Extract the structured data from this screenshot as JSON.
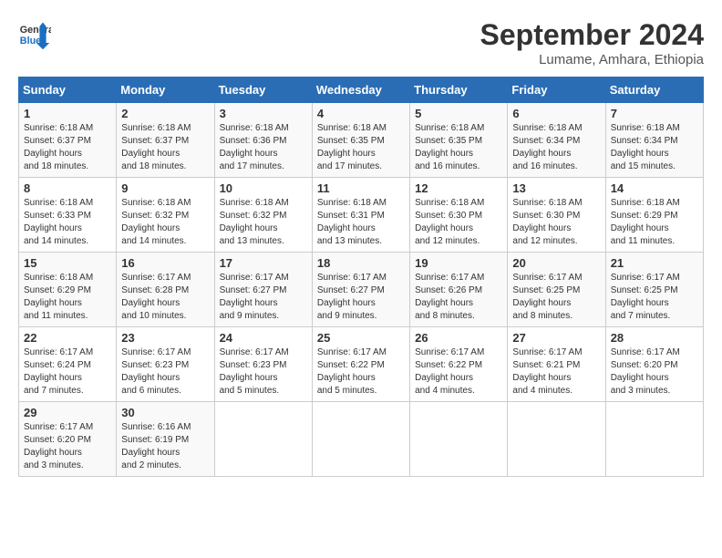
{
  "header": {
    "logo_line1": "General",
    "logo_line2": "Blue",
    "month": "September 2024",
    "location": "Lumame, Amhara, Ethiopia"
  },
  "weekdays": [
    "Sunday",
    "Monday",
    "Tuesday",
    "Wednesday",
    "Thursday",
    "Friday",
    "Saturday"
  ],
  "weeks": [
    [
      {
        "day": "1",
        "rise": "6:18 AM",
        "set": "6:37 PM",
        "daylight": "12 hours and 18 minutes."
      },
      {
        "day": "2",
        "rise": "6:18 AM",
        "set": "6:37 PM",
        "daylight": "12 hours and 18 minutes."
      },
      {
        "day": "3",
        "rise": "6:18 AM",
        "set": "6:36 PM",
        "daylight": "12 hours and 17 minutes."
      },
      {
        "day": "4",
        "rise": "6:18 AM",
        "set": "6:35 PM",
        "daylight": "12 hours and 17 minutes."
      },
      {
        "day": "5",
        "rise": "6:18 AM",
        "set": "6:35 PM",
        "daylight": "12 hours and 16 minutes."
      },
      {
        "day": "6",
        "rise": "6:18 AM",
        "set": "6:34 PM",
        "daylight": "12 hours and 16 minutes."
      },
      {
        "day": "7",
        "rise": "6:18 AM",
        "set": "6:34 PM",
        "daylight": "12 hours and 15 minutes."
      }
    ],
    [
      {
        "day": "8",
        "rise": "6:18 AM",
        "set": "6:33 PM",
        "daylight": "12 hours and 14 minutes."
      },
      {
        "day": "9",
        "rise": "6:18 AM",
        "set": "6:32 PM",
        "daylight": "12 hours and 14 minutes."
      },
      {
        "day": "10",
        "rise": "6:18 AM",
        "set": "6:32 PM",
        "daylight": "12 hours and 13 minutes."
      },
      {
        "day": "11",
        "rise": "6:18 AM",
        "set": "6:31 PM",
        "daylight": "12 hours and 13 minutes."
      },
      {
        "day": "12",
        "rise": "6:18 AM",
        "set": "6:30 PM",
        "daylight": "12 hours and 12 minutes."
      },
      {
        "day": "13",
        "rise": "6:18 AM",
        "set": "6:30 PM",
        "daylight": "12 hours and 12 minutes."
      },
      {
        "day": "14",
        "rise": "6:18 AM",
        "set": "6:29 PM",
        "daylight": "12 hours and 11 minutes."
      }
    ],
    [
      {
        "day": "15",
        "rise": "6:18 AM",
        "set": "6:29 PM",
        "daylight": "12 hours and 11 minutes."
      },
      {
        "day": "16",
        "rise": "6:17 AM",
        "set": "6:28 PM",
        "daylight": "12 hours and 10 minutes."
      },
      {
        "day": "17",
        "rise": "6:17 AM",
        "set": "6:27 PM",
        "daylight": "12 hours and 9 minutes."
      },
      {
        "day": "18",
        "rise": "6:17 AM",
        "set": "6:27 PM",
        "daylight": "12 hours and 9 minutes."
      },
      {
        "day": "19",
        "rise": "6:17 AM",
        "set": "6:26 PM",
        "daylight": "12 hours and 8 minutes."
      },
      {
        "day": "20",
        "rise": "6:17 AM",
        "set": "6:25 PM",
        "daylight": "12 hours and 8 minutes."
      },
      {
        "day": "21",
        "rise": "6:17 AM",
        "set": "6:25 PM",
        "daylight": "12 hours and 7 minutes."
      }
    ],
    [
      {
        "day": "22",
        "rise": "6:17 AM",
        "set": "6:24 PM",
        "daylight": "12 hours and 7 minutes."
      },
      {
        "day": "23",
        "rise": "6:17 AM",
        "set": "6:23 PM",
        "daylight": "12 hours and 6 minutes."
      },
      {
        "day": "24",
        "rise": "6:17 AM",
        "set": "6:23 PM",
        "daylight": "12 hours and 5 minutes."
      },
      {
        "day": "25",
        "rise": "6:17 AM",
        "set": "6:22 PM",
        "daylight": "12 hours and 5 minutes."
      },
      {
        "day": "26",
        "rise": "6:17 AM",
        "set": "6:22 PM",
        "daylight": "12 hours and 4 minutes."
      },
      {
        "day": "27",
        "rise": "6:17 AM",
        "set": "6:21 PM",
        "daylight": "12 hours and 4 minutes."
      },
      {
        "day": "28",
        "rise": "6:17 AM",
        "set": "6:20 PM",
        "daylight": "12 hours and 3 minutes."
      }
    ],
    [
      {
        "day": "29",
        "rise": "6:17 AM",
        "set": "6:20 PM",
        "daylight": "12 hours and 3 minutes."
      },
      {
        "day": "30",
        "rise": "6:16 AM",
        "set": "6:19 PM",
        "daylight": "12 hours and 2 minutes."
      },
      null,
      null,
      null,
      null,
      null
    ]
  ]
}
